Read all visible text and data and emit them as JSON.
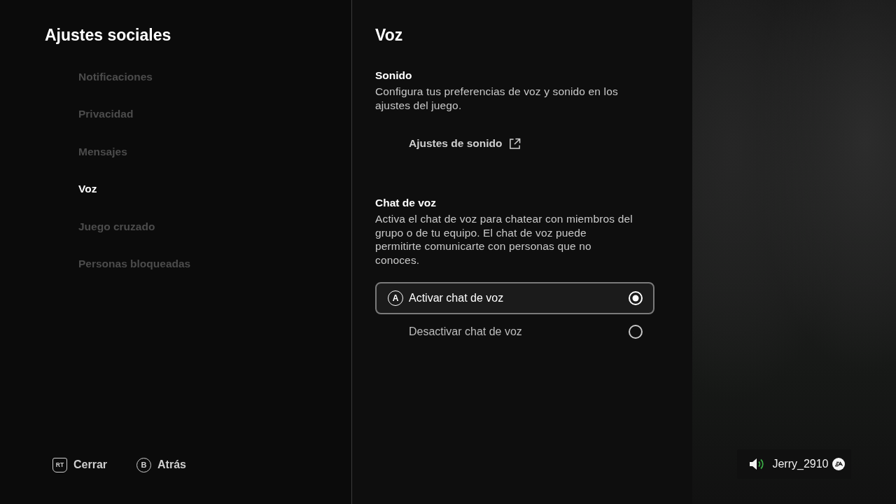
{
  "sidebar": {
    "title": "Ajustes sociales",
    "items": [
      {
        "label": "Notificaciones",
        "selected": false
      },
      {
        "label": "Privacidad",
        "selected": false
      },
      {
        "label": "Mensajes",
        "selected": false
      },
      {
        "label": "Voz",
        "selected": true
      },
      {
        "label": "Juego cruzado",
        "selected": false
      },
      {
        "label": "Personas bloqueadas",
        "selected": false
      }
    ]
  },
  "footer_hints": [
    {
      "kind": "trigger",
      "button": "RT",
      "label": "Cerrar"
    },
    {
      "kind": "face",
      "button": "B",
      "label": "Atrás"
    }
  ],
  "panel": {
    "title": "Voz",
    "sections": [
      {
        "heading": "Sonido",
        "description": "Configura tus preferencias de voz y sonido en los ajustes del juego.",
        "link": {
          "label": "Ajustes de sonido"
        }
      },
      {
        "heading": "Chat de voz",
        "description": "Activa el chat de voz para chatear con miembros del grupo o de tu equipo. El chat de voz puede permitirte comunicarte con personas que no conoces.",
        "options": [
          {
            "label": "Activar chat de voz",
            "button_glyph": "A",
            "focused": true,
            "selected": true
          },
          {
            "label": "Desactivar chat de voz",
            "focused": false,
            "selected": false
          }
        ]
      }
    ]
  },
  "user": {
    "name": "Jerry_2910"
  }
}
